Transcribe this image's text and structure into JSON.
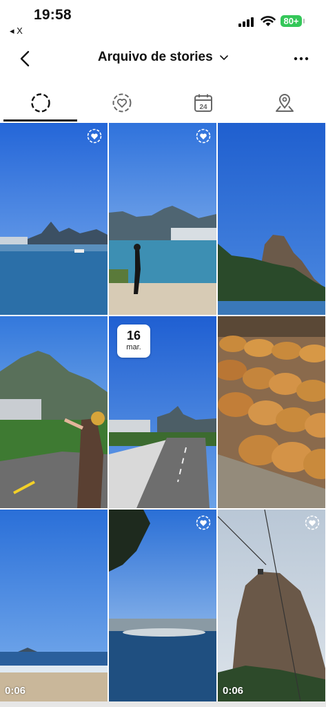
{
  "status_bar": {
    "time": "19:58",
    "back_app": "◂ X",
    "battery": "80+"
  },
  "header": {
    "title": "Arquivo de stories",
    "back_icon": "chevron-left-icon",
    "more_icon": "ellipsis-icon"
  },
  "tabs": [
    {
      "icon": "story-circle-icon",
      "active": true
    },
    {
      "icon": "heart-circle-icon",
      "active": false
    },
    {
      "icon": "calendar-icon",
      "label": "24",
      "active": false
    },
    {
      "icon": "location-pin-icon",
      "active": false
    }
  ],
  "grid": {
    "items": [
      {
        "scene": "lagoon-city-skyline",
        "liked": true
      },
      {
        "scene": "woman-on-lagoon-walkway",
        "liked": true
      },
      {
        "scene": "sugarloaf-mountain"
      },
      {
        "scene": "bike-path-mountain"
      },
      {
        "scene": "street-mountain-view",
        "date_day": "16",
        "date_month": "mar."
      },
      {
        "scene": "croissant-bakery-display"
      },
      {
        "scene": "ocean-beach",
        "duration": "0:06"
      },
      {
        "scene": "bay-aerial-view",
        "liked": true
      },
      {
        "scene": "cable-car-mountain",
        "duration": "0:06",
        "liked": true
      }
    ]
  },
  "colors": {
    "sky": "#2f6fd6",
    "battery": "#34c759",
    "accent": "#111111"
  }
}
